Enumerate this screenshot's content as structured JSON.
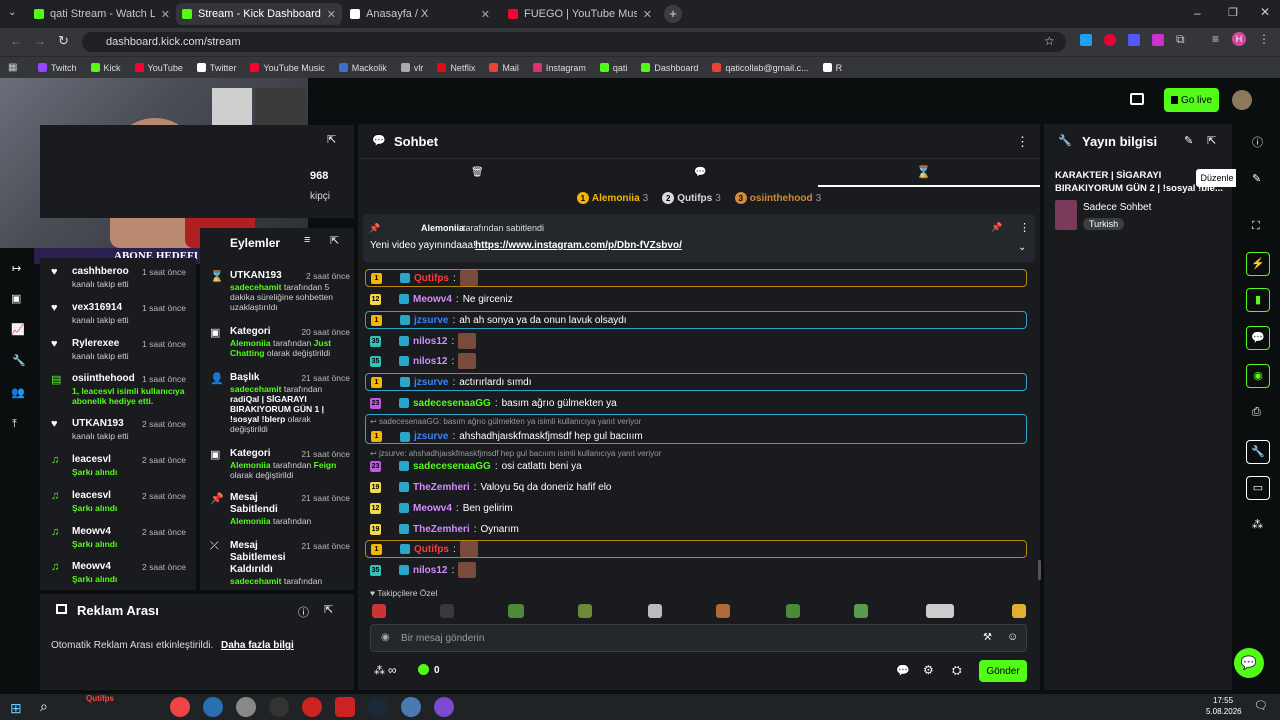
{
  "browser": {
    "tabs": [
      {
        "label": "qati Stream - Watch Live on Kic",
        "color": "#53fc18"
      },
      {
        "label": "Stream - Kick Dashboard",
        "color": "#53fc18"
      },
      {
        "label": "Anasayfa / X",
        "color": "#ffffff"
      },
      {
        "label": "FUEGO | YouTube Music",
        "color": "#ff0033"
      }
    ],
    "url": "dashboard.kick.com/stream",
    "bookmarks": [
      "Twitch",
      "Kick",
      "YouTube",
      "Twitter",
      "YouTube Music",
      "Mackolik",
      "vlr",
      "Netflix",
      "Mail",
      "Instagram",
      "qati",
      "Dashboard",
      "qaticollab@gmail.c...",
      "R"
    ],
    "avatar_letter": "H"
  },
  "header": {
    "go_live": "Go live"
  },
  "overlay": {
    "goal_label": "ABONE HEDEFI",
    "goal_left": "2",
    "goal_right": "5"
  },
  "stats_partial": {
    "num": "968",
    "label": "kipçi"
  },
  "activity": [
    {
      "name": "cashhberoo",
      "sub": "kanalı takip etti",
      "time": "1 saat önce",
      "icon": "heart"
    },
    {
      "name": "vex316914",
      "sub": "kanalı takip etti",
      "time": "1 saat önce",
      "icon": "heart"
    },
    {
      "name": "Rylerexee",
      "sub": "kanalı takip etti",
      "time": "1 saat önce",
      "icon": "heart"
    },
    {
      "name": "osiinthehood",
      "sub": "1, leacesvl isimli kullanıcıya abonelik hediye etti.",
      "time": "1 saat önce",
      "icon": "gift",
      "green": true
    },
    {
      "name": "UTKAN193",
      "sub": "kanalı takip etti",
      "time": "2 saat önce",
      "icon": "heart"
    },
    {
      "name": "leacesvl",
      "sub": "Şarkı alındı",
      "time": "2 saat önce",
      "icon": "music",
      "green": true
    },
    {
      "name": "leacesvl",
      "sub": "Şarkı alındı",
      "time": "2 saat önce",
      "icon": "music",
      "green": true
    },
    {
      "name": "Meowv4",
      "sub": "Şarkı alındı",
      "time": "2 saat önce",
      "icon": "music",
      "green": true
    },
    {
      "name": "Meowv4",
      "sub": "Şarkı alındı",
      "time": "2 saat önce",
      "icon": "music",
      "green": true
    }
  ],
  "modlog": [
    {
      "title": "UTKAN193",
      "time": "2 saat önce",
      "hl": "sadecehamit",
      "rest": "tarafından 5 dakika süreliğine sohbetten uzaklaştırıldı"
    },
    {
      "title": "Kategori",
      "time": "20 saat önce",
      "hl": "Alemoniia",
      "rest": "tarafından",
      "hl2": "Just Chatting",
      "rest2": "olarak değiştirildi"
    },
    {
      "title": "Başlık",
      "time": "21 saat önce",
      "hl": "sadecehamit",
      "rest": "tarafından",
      "bold": "radiQal | SİGARAYI BIRAKIYORUM GÜN 1 | !sosyal !blerp",
      "rest2": "olarak değiştirildi"
    },
    {
      "title": "Kategori",
      "time": "21 saat önce",
      "hl": "Alemoniia",
      "rest": "tarafından",
      "hl2": "Feign",
      "rest2": "olarak değiştirildi"
    },
    {
      "title": "Mesaj Sabitlendi",
      "time": "21 saat önce",
      "hl": "Alemoniia",
      "rest": "tarafından"
    },
    {
      "title": "Mesaj Sabitlemesi Kaldırıldı",
      "time": "21 saat önce",
      "hl": "sadecehamit",
      "rest": "tarafından"
    }
  ],
  "partial_header": "Eylemler",
  "ads": {
    "title": "Reklam Arası",
    "text": "Otomatik Reklam Arası etkinleştirildi.",
    "link": "Daha fazla bilgi"
  },
  "chat": {
    "title": "Sohbet",
    "leaders": [
      {
        "rank": "1",
        "name": "Alemoniia",
        "count": "3"
      },
      {
        "rank": "2",
        "name": "Qutifps",
        "count": "3"
      },
      {
        "rank": "3",
        "name": "osiinthehood",
        "count": "3"
      }
    ],
    "pinned_by": "Alemoniia",
    "pinned_suffix": "tarafından sabitlendi",
    "pinned_text": "Yeni video yayınındaaa!",
    "pinned_link": "https://www.instagram.com/p/Dbn-fVZsbvo/",
    "messages": [
      {
        "user": "Qutifps",
        "text": "",
        "color": "#ff3b3b",
        "hl": "#b8860b",
        "badge": "1",
        "badgecol": "#f2b705",
        "emote": true
      },
      {
        "user": "Meowv4",
        "text": "Ne girceniz",
        "color": "#d38cff",
        "badge": "12",
        "badgecol": "#f2d94e"
      },
      {
        "user": "jzsurve",
        "text": "ah ah sonya ya da onun lavuk olsaydı",
        "color": "#3b82f6",
        "hl": "#2aa6c9",
        "badge": "1",
        "badgecol": "#f2b705"
      },
      {
        "user": "nilos12",
        "text": "",
        "color": "#d38cff",
        "badge": "35",
        "badgecol": "#2ec4b6",
        "emote": true
      },
      {
        "user": "nilos12",
        "text": "",
        "color": "#d38cff",
        "badge": "35",
        "badgecol": "#2ec4b6",
        "emote": true
      },
      {
        "user": "jzsurve",
        "text": "actırırlardı sımdı",
        "color": "#3b82f6",
        "hl": "#2aa6c9",
        "badge": "1",
        "badgecol": "#f2b705"
      },
      {
        "user": "sadecesenaaGG",
        "text": "basım ağrıo gülmekten ya",
        "color": "#53fc18",
        "badge": "23",
        "badgecol": "#c058e0"
      },
      {
        "reply": "sadecesenaaGG: basım ağrıo gülmekten ya isimli kullanıcıya yanıt veriyor",
        "user": "jzsurve",
        "text": "ahshadhjaıskfmaskfjmsdf hep gul bacııım",
        "color": "#3b82f6",
        "hl": "#2aa6c9",
        "badge": "1",
        "badgecol": "#f2b705"
      },
      {
        "reply": "jzsurve: ahshadhjaıskfmaskfjmsdf hep gul bacııım isimli kullanıcıya yanıt veriyor",
        "user": "sadecesenaaGG",
        "text": "osi catlattı beni ya",
        "color": "#53fc18",
        "badge": "23",
        "badgecol": "#c058e0"
      },
      {
        "user": "TheZemheri",
        "text": "Valoyu 5q da doneriz hafif elo",
        "color": "#d38cff",
        "badge": "19",
        "badgecol": "#f2d94e"
      },
      {
        "user": "Meowv4",
        "text": "Ben gelirim",
        "color": "#d38cff",
        "badge": "12",
        "badgecol": "#f2d94e"
      },
      {
        "user": "TheZemheri",
        "text": "Oynarım",
        "color": "#d38cff",
        "badge": "19",
        "badgecol": "#f2d94e"
      },
      {
        "user": "Qutifps",
        "text": "",
        "color": "#ff3b3b",
        "hl": "#b8860b",
        "badge": "1",
        "badgecol": "#f2b705",
        "emote": true
      },
      {
        "user": "nilos12",
        "text": "",
        "color": "#d38cff",
        "badge": "35",
        "badgecol": "#2ec4b6",
        "emote": true
      }
    ],
    "followers_only": "Takipçilere Özel",
    "input_placeholder": "Bir mesaj gönderin",
    "send": "Gönder",
    "infinity": "∞",
    "points": "0"
  },
  "streaminfo": {
    "title": "Yayın bilgisi",
    "stream_title": "KARAKTER | SİGARAYI BIRAKIYORUM GÜN 2 | !sosyal !ble...",
    "category": "Sadece Sohbet",
    "tag": "Turkish",
    "tooltip": "Düzenle"
  },
  "taskbar": {
    "time": "17:55",
    "date": "5.08.2026",
    "overlay_name": "Qutifps"
  }
}
